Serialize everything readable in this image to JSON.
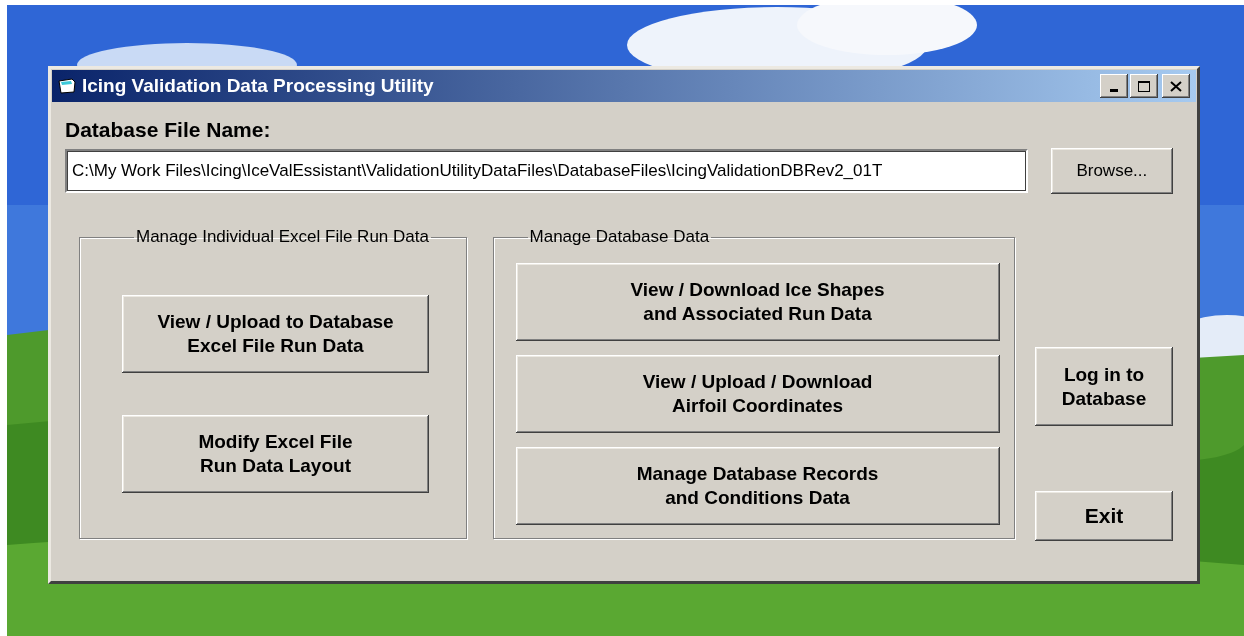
{
  "desktop": {
    "kind": "picture"
  },
  "window": {
    "title": "Icing Validation Data Processing Utility"
  },
  "file": {
    "label": "Database File Name:",
    "value": "C:\\My Work Files\\Icing\\IceValEssistant\\ValidationUtilityDataFiles\\DatabaseFiles\\IcingValidationDBRev2_01T",
    "browse": "Browse..."
  },
  "groups": [
    {
      "title": "Manage Individual Excel File Run Data",
      "kind": "spaced",
      "buttons": [
        "View / Upload to Database\nExcel File Run Data",
        "Modify Excel File\nRun Data Layout"
      ]
    },
    {
      "title": "Manage Database Data",
      "kind": "stacked",
      "buttons": [
        "View / Download Ice Shapes\nand Associated Run Data",
        "View / Upload / Download\nAirfoil Coordinates",
        "Manage Database Records\nand Conditions Data"
      ]
    }
  ],
  "side_buttons": [
    "Log in to\nDatabase",
    "Exit"
  ]
}
